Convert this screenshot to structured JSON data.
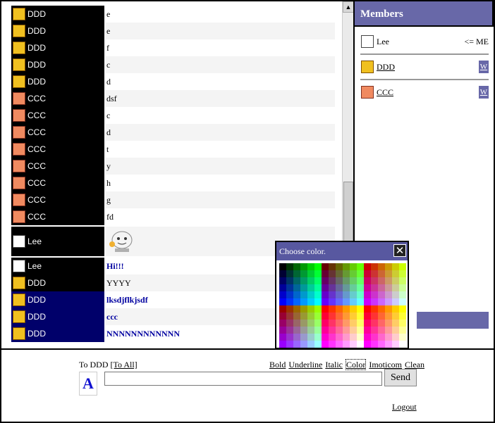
{
  "chat": {
    "rows": [
      {
        "user": "DDD",
        "avatar": "crown-avatar-icon",
        "text": "e"
      },
      {
        "user": "DDD",
        "avatar": "crown-avatar-icon",
        "text": "e"
      },
      {
        "user": "DDD",
        "avatar": "crown-avatar-icon",
        "text": "f"
      },
      {
        "user": "DDD",
        "avatar": "crown-avatar-icon",
        "text": "c"
      },
      {
        "user": "DDD",
        "avatar": "crown-avatar-icon",
        "text": "d"
      },
      {
        "user": "CCC",
        "avatar": "face-avatar-icon",
        "text": "dsf"
      },
      {
        "user": "CCC",
        "avatar": "face-avatar-icon",
        "text": "c"
      },
      {
        "user": "CCC",
        "avatar": "face-avatar-icon",
        "text": "d"
      },
      {
        "user": "CCC",
        "avatar": "face-avatar-icon",
        "text": "t"
      },
      {
        "user": "CCC",
        "avatar": "face-avatar-icon",
        "text": "y"
      },
      {
        "user": "CCC",
        "avatar": "face-avatar-icon",
        "text": "h"
      },
      {
        "user": "CCC",
        "avatar": "face-avatar-icon",
        "text": "g"
      },
      {
        "user": "CCC",
        "avatar": "face-avatar-icon",
        "text": "fd"
      },
      {
        "user": "Lee",
        "avatar": "lee-avatar-icon",
        "text": "",
        "emoticon": "robot-emoticon-icon"
      },
      {
        "user": "Lee",
        "avatar": "lee-avatar-icon",
        "text": "Hi!!!",
        "style": "blue"
      },
      {
        "user": "DDD",
        "avatar": "crown-avatar-icon",
        "text": "YYYY"
      },
      {
        "user": "DDD",
        "avatar": "crown-avatar-icon",
        "text": "lksdjflkjsdf",
        "style": "blue",
        "highlight": "navy"
      },
      {
        "user": "DDD",
        "avatar": "crown-avatar-icon",
        "text": "ccc",
        "style": "blue",
        "highlight": "navy"
      },
      {
        "user": "DDD",
        "avatar": "crown-avatar-icon",
        "text": "NNNNNNNNNNNN",
        "style": "blue",
        "highlight": "navy"
      }
    ]
  },
  "members": {
    "title": "Members",
    "list": [
      {
        "name": "Lee",
        "avatar": "lee-avatar-icon",
        "tag": "<= ME"
      },
      {
        "name": "DDD",
        "avatar": "crown-avatar-icon",
        "whisper": "W"
      },
      {
        "name": "CCC",
        "avatar": "face-avatar-icon",
        "whisper": "W"
      }
    ]
  },
  "input": {
    "to_label": "To DDD",
    "to_all": "[To All]",
    "toolbar": [
      "Bold",
      "Underline",
      "Italic",
      "Color",
      "Imoticom",
      "Clean"
    ],
    "font_button": "A",
    "value": "",
    "send": "Send",
    "logout": "Logout"
  },
  "picker": {
    "title": "Choose color.",
    "close": "✕"
  },
  "colors": {
    "accent": "#6868a8",
    "user_bg": "#000000",
    "highlight_bg": "#00006a",
    "message_blue": "#0000a0"
  }
}
